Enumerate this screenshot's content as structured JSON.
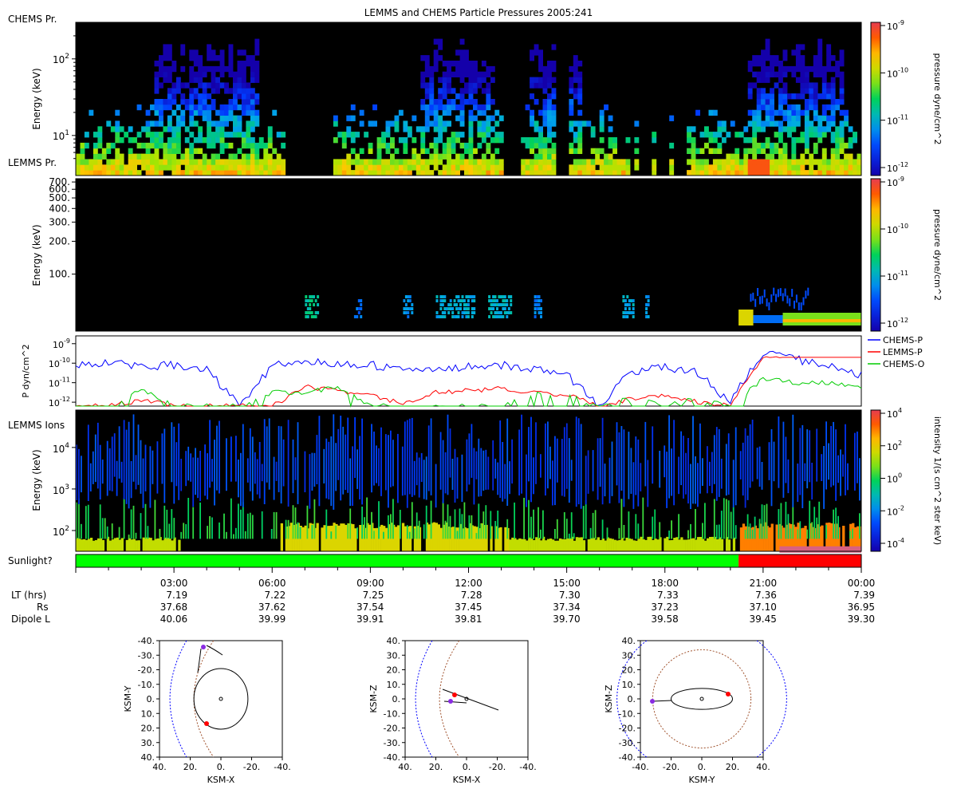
{
  "title": "LEMMS and CHEMS Particle Pressures  2005:241",
  "panels": {
    "chems": {
      "label": "CHEMS Pr.",
      "ylabel": "Energy (keV)",
      "yticks": [
        {
          "v": 10,
          "t": "10",
          "sup": "1"
        },
        {
          "v": 100,
          "t": "10",
          "sup": "2"
        }
      ],
      "ylim": [
        3,
        300
      ]
    },
    "lemms_pr": {
      "label": "LEMMS Pr.",
      "ylabel": "Energy (keV)",
      "yticks": [
        "700.",
        "600.",
        "500.",
        "400.",
        "300.",
        "200.",
        "100."
      ],
      "ylim": [
        30,
        750
      ]
    },
    "pressure": {
      "ylabel": "P dyn/cm^2",
      "yticks": [
        {
          "v": -9,
          "t": "10",
          "sup": "-9"
        },
        {
          "v": -10,
          "t": "10",
          "sup": "-10"
        },
        {
          "v": -11,
          "t": "10",
          "sup": "-11"
        },
        {
          "v": -12,
          "t": "10",
          "sup": "-12"
        }
      ],
      "ylim_exp": [
        -12.2,
        -8.6
      ],
      "legend": [
        {
          "name": "CHEMS-P",
          "color": "#0000ff"
        },
        {
          "name": "LEMMS-P",
          "color": "#ff0000"
        },
        {
          "name": "CHEMS-O",
          "color": "#00cc00"
        }
      ]
    },
    "lemms_ions": {
      "label": "LEMMS Ions",
      "ylabel": "Energy (keV)",
      "yticks": [
        {
          "v": 2,
          "t": "10",
          "sup": "2"
        },
        {
          "v": 3,
          "t": "10",
          "sup": "3"
        },
        {
          "v": 4,
          "t": "10",
          "sup": "4"
        }
      ],
      "ylim_exp": [
        1.5,
        4.9
      ]
    },
    "sunlight": {
      "label": "Sunlight?",
      "segments": [
        {
          "from": 0,
          "to": 20.25,
          "color": "#00ff00"
        },
        {
          "from": 20.25,
          "to": 24,
          "color": "#ff0000"
        }
      ]
    }
  },
  "colorbars": [
    {
      "label": "pressure dyne/cm^2",
      "ticks": [
        {
          "t": "10",
          "sup": "-9"
        },
        {
          "t": "10",
          "sup": "-10"
        },
        {
          "t": "10",
          "sup": "-11"
        },
        {
          "t": "10",
          "sup": "-12"
        }
      ]
    },
    {
      "label": "pressure dyne/cm^2",
      "ticks": [
        {
          "t": "10",
          "sup": "-9"
        },
        {
          "t": "10",
          "sup": "-10"
        },
        {
          "t": "10",
          "sup": "-11"
        },
        {
          "t": "10",
          "sup": "-12"
        }
      ]
    },
    {
      "label": "intensity 1/(s cm^2 ster keV)",
      "ticks": [
        {
          "t": "10",
          "sup": "4"
        },
        {
          "t": "10",
          "sup": "2"
        },
        {
          "t": "10",
          "sup": "0"
        },
        {
          "t": "10",
          "sup": "-2"
        },
        {
          "t": "10",
          "sup": "-4"
        }
      ]
    }
  ],
  "time_axis": {
    "ticks": [
      "03:00",
      "06:00",
      "09:00",
      "12:00",
      "15:00",
      "18:00",
      "21:00",
      "00:00"
    ],
    "hours": [
      3,
      6,
      9,
      12,
      15,
      18,
      21,
      24
    ],
    "rows": [
      {
        "label": "LT (hrs)",
        "values": [
          "7.19",
          "7.22",
          "7.25",
          "7.28",
          "7.30",
          "7.33",
          "7.36",
          "7.39"
        ]
      },
      {
        "label": "Rs",
        "values": [
          "37.68",
          "37.62",
          "37.54",
          "37.45",
          "37.34",
          "37.23",
          "37.10",
          "36.95"
        ]
      },
      {
        "label": "Dipole L",
        "values": [
          "40.06",
          "39.99",
          "39.91",
          "39.81",
          "39.70",
          "39.58",
          "39.45",
          "39.30"
        ]
      }
    ]
  },
  "orbit_plots": [
    {
      "xlabel": "KSM-X",
      "ylabel": "KSM-Y",
      "xticks": [
        "40.",
        "20.",
        "0.",
        "-20.",
        "-40."
      ],
      "yticks": [
        "-40.",
        "-30.",
        "-20.",
        "-10.",
        "0.",
        "10.",
        "20.",
        "30.",
        "40."
      ]
    },
    {
      "xlabel": "KSM-X",
      "ylabel": "KSM-Z",
      "xticks": [
        "40.",
        "20.",
        "0.",
        "-20.",
        "-40."
      ],
      "yticks": [
        "40.",
        "30.",
        "20.",
        "10.",
        "0.",
        "-10.",
        "-20.",
        "-30.",
        "-40."
      ]
    },
    {
      "xlabel": "KSM-Y",
      "ylabel": "KSM-Z",
      "xticks": [
        "-40.",
        "-20.",
        "0.",
        "20.",
        "40."
      ],
      "yticks": [
        "40.",
        "30.",
        "20.",
        "10.",
        "0.",
        "-10.",
        "-20.",
        "-30.",
        "-40."
      ]
    }
  ],
  "chart_data": {
    "type": "line",
    "title": "LEMMS and CHEMS Particle Pressures  2005:241",
    "xlabel": "",
    "ylabel": "P dyn/cm^2",
    "x_hours": [
      0,
      1,
      2,
      3,
      4,
      5,
      6,
      7,
      8,
      9,
      10,
      11,
      12,
      13,
      14,
      15,
      16,
      17,
      18,
      19,
      20,
      21,
      22,
      23,
      24
    ],
    "series": [
      {
        "name": "CHEMS-P",
        "log10_values": [
          -10.1,
          -10.0,
          -10.2,
          -10.1,
          -10.3,
          -12.2,
          -10.1,
          -9.9,
          -10.0,
          -10.1,
          -10.3,
          -10.4,
          -10.2,
          -10.1,
          -10.3,
          -10.6,
          -12.2,
          -10.4,
          -10.2,
          -10.5,
          -12.0,
          -9.4,
          -9.8,
          -10.1,
          -10.6
        ]
      },
      {
        "name": "LEMMS-P",
        "log10_values": [
          -12.2,
          -12.2,
          -11.9,
          -12.2,
          -12.2,
          -12.2,
          -12.2,
          -11.2,
          -11.4,
          -11.6,
          -12.1,
          -11.5,
          -11.4,
          -11.3,
          -11.5,
          -11.6,
          -12.2,
          -11.8,
          -11.6,
          -12.0,
          -12.2,
          -9.6,
          -9.7,
          -9.7,
          -9.7
        ]
      },
      {
        "name": "CHEMS-O",
        "log10_values": [
          -12.2,
          -12.2,
          -11.3,
          -12.2,
          -12.2,
          -12.2,
          -11.5,
          -11.5,
          -11.2,
          -12.2,
          -12.2,
          -12.2,
          -12.2,
          -12.2,
          -11.6,
          -11.6,
          -12.2,
          -11.8,
          -12.2,
          -11.8,
          -12.2,
          -10.8,
          -11.0,
          -11.0,
          -11.2
        ]
      }
    ],
    "ylim": [
      -12.2,
      -8.6
    ],
    "xlim": [
      0,
      24
    ]
  }
}
